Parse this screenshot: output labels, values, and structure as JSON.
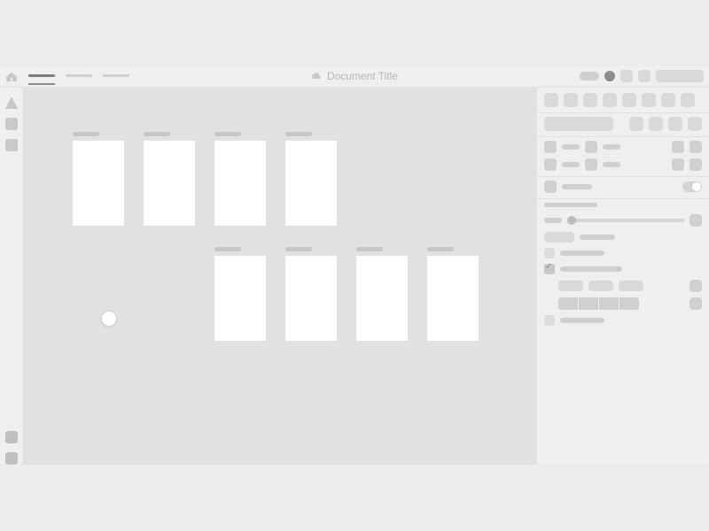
{
  "titlebar": {
    "doc_title": "Document Title",
    "tabs": [
      "",
      "",
      ""
    ],
    "active_tab": 0
  },
  "toolstrip": {
    "tools": [
      "pointer",
      "shape",
      "rect"
    ],
    "bottom": [
      "a",
      "b"
    ]
  },
  "canvas": {
    "artboards_row1": 4,
    "artboards_row2": 4,
    "artboard_w": 58,
    "artboard_h": 96
  },
  "inspector": {
    "align_count": 8,
    "toggle_on": true,
    "checkbox_checked": true,
    "segments": 4
  }
}
